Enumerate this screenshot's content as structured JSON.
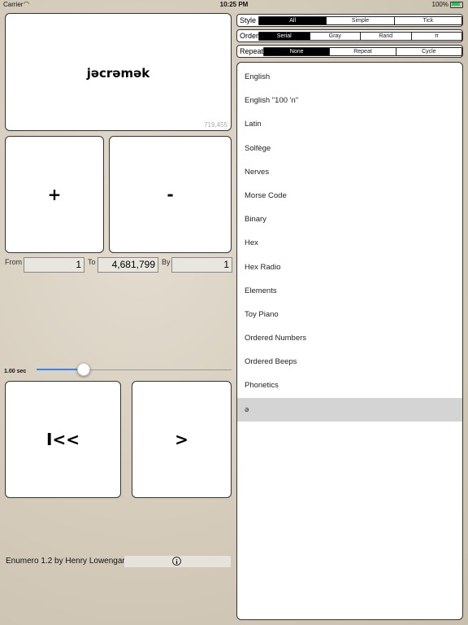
{
  "status_bar": {
    "carrier": "Carrier",
    "time": "10:25 PM",
    "battery": "100%"
  },
  "display": {
    "word": "jəcrəmək",
    "count": "719,455"
  },
  "buttons": {
    "plus": "+",
    "minus": "-",
    "rewind": "I<<",
    "play": ">"
  },
  "range": {
    "from_label": "From",
    "from_value": "1",
    "to_label": "To",
    "to_value": "4,681,799",
    "by_label": "By",
    "by_value": "1"
  },
  "speed": {
    "label": "1.00 sec",
    "level": 0.24
  },
  "footer": {
    "credit": "Enumero 1.2 by Henry Lowengard"
  },
  "style_control": {
    "title": "Style",
    "options": [
      "All",
      "Simple",
      "Tick"
    ],
    "selected": "All"
  },
  "order_control": {
    "title": "Order",
    "options": [
      "Serial",
      "Gray",
      "Rand",
      "π"
    ],
    "selected": "Serial"
  },
  "repeat_control": {
    "title": "Repeat",
    "options": [
      "None",
      "Repeat",
      "Cycle"
    ],
    "selected": "None"
  },
  "languages": {
    "items": [
      "English",
      "English \"100 'n\"",
      "Latin",
      "Solfège",
      "Nerves",
      "Morse Code",
      "Binary",
      "Hex",
      "Hex Radio",
      "Elements",
      "Toy Piano",
      "Ordered Numbers",
      "Ordered Beeps",
      "Phonetics",
      "ə"
    ],
    "selected": "ə"
  },
  "colors": {
    "accent": "#3b82f6",
    "selection": "#d4d4d4",
    "segment_selected": "#000000"
  }
}
